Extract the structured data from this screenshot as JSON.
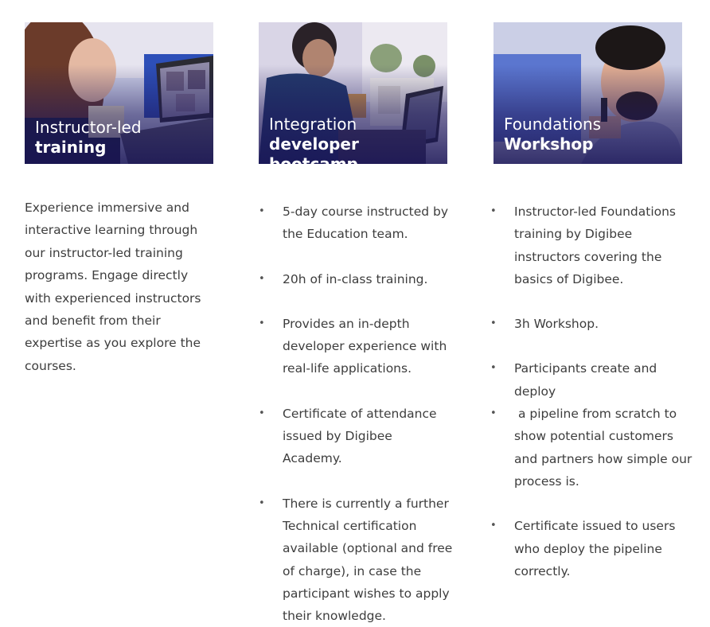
{
  "cards": [
    {
      "title_line1": "Instructor-led",
      "title_line2": "training",
      "description": "Experience immersive and interactive learning through our instructor-led training programs. Engage directly with experienced instructors and benefit from their expertise as you explore the courses."
    },
    {
      "title_line1": "Integration",
      "title_line2": "developer bootcamp",
      "bullets": [
        "5-day course instructed by the Education team.",
        "20h of in-class training.",
        "Provides an in-depth developer experience with real-life applications.",
        "Certificate of attendance issued by Digibee Academy.",
        "There is currently a further Technical certification available (optional and free of charge), in case the participant wishes to apply their knowledge."
      ]
    },
    {
      "title_line1": "Foundations",
      "title_line2": "Workshop",
      "bullets": [
        "Instructor-led Foundations training by Digibee instructors covering the basics of Digibee.",
        "3h Workshop.",
        "Participants create and deploy",
        " a pipeline from scratch to show potential customers and partners how simple our process is.",
        "Certificate issued to users who deploy the pipeline correctly."
      ]
    }
  ]
}
